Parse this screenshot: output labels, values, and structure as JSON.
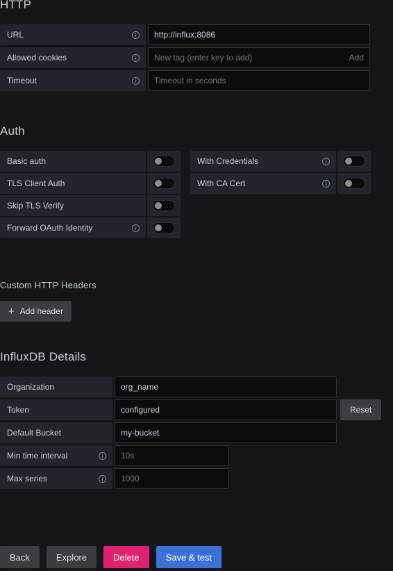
{
  "sections": {
    "http": {
      "title": "HTTP",
      "fields": [
        {
          "label": "URL",
          "info": true,
          "value": "http://influx:8086",
          "placeholder": "",
          "is_placeholder": false
        },
        {
          "label": "Allowed cookies",
          "info": true,
          "value": "",
          "placeholder": "New tag (enter key to add)",
          "is_placeholder": true,
          "suffix": "Add"
        },
        {
          "label": "Timeout",
          "info": true,
          "value": "",
          "placeholder": "Timeout in seconds",
          "is_placeholder": true
        }
      ]
    },
    "auth": {
      "title": "Auth",
      "rows": [
        {
          "left": {
            "label": "Basic auth",
            "info": false,
            "enabled": false
          },
          "right": {
            "label": "With Credentials",
            "info": true,
            "enabled": false
          }
        },
        {
          "left": {
            "label": "TLS Client Auth",
            "info": false,
            "enabled": false
          },
          "right": {
            "label": "With CA Cert",
            "info": true,
            "enabled": false
          }
        },
        {
          "left": {
            "label": "Skip TLS Verify",
            "info": false,
            "enabled": false
          },
          "right": null
        },
        {
          "left": {
            "label": "Forward OAuth Identity",
            "info": true,
            "enabled": false
          },
          "right": null
        }
      ]
    },
    "custom_headers": {
      "title": "Custom HTTP Headers",
      "add_button_label": "Add header",
      "add_button_icon": "plus-icon"
    },
    "influxdb": {
      "title": "InfluxDB Details",
      "fields": [
        {
          "label": "Organization",
          "info": false,
          "value": "org_name",
          "placeholder": "",
          "is_placeholder": false,
          "width": "wide"
        },
        {
          "label": "Token",
          "info": false,
          "value": "configured",
          "placeholder": "",
          "is_placeholder": false,
          "width": "wide",
          "reset_label": "Reset"
        },
        {
          "label": "Default Bucket",
          "info": false,
          "value": "my-bucket",
          "placeholder": "",
          "is_placeholder": false,
          "width": "wide"
        },
        {
          "label": "Min time interval",
          "info": true,
          "value": "",
          "placeholder": "10s",
          "is_placeholder": true,
          "width": "narrow"
        },
        {
          "label": "Max series",
          "info": true,
          "value": "",
          "placeholder": "1000",
          "is_placeholder": true,
          "width": "narrow"
        }
      ]
    }
  },
  "actions": [
    {
      "label": "Back",
      "style": "grey"
    },
    {
      "label": "Explore",
      "style": "grey"
    },
    {
      "label": "Delete",
      "style": "pink"
    },
    {
      "label": "Save & test",
      "style": "blue"
    }
  ],
  "colors": {
    "page_background": "#141619",
    "label_background": "#22252b",
    "input_background": "#0b0c0e",
    "input_border": "#2c3235",
    "text_primary": "#ccccdc",
    "text_muted": "#6e7276",
    "heading": "#c7d0d9",
    "button_grey": "#3a3d42",
    "button_delete": "#e0226e",
    "button_save": "#3d71d9",
    "toggle_knob": "#8e8e8e"
  }
}
